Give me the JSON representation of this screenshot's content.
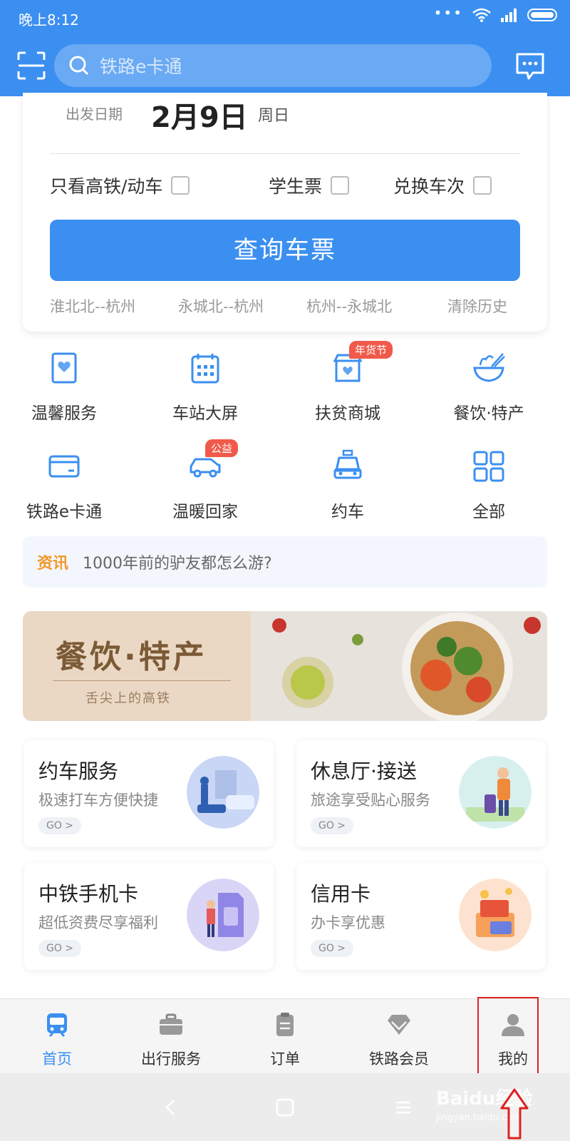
{
  "status_bar": {
    "time": "晚上8:12",
    "dots": "•••"
  },
  "header": {
    "search_placeholder": "铁路e卡通"
  },
  "query": {
    "date_label": "出发日期",
    "date_value": "2月9日",
    "weekday": "周日",
    "options": [
      "只看高铁/动车",
      "学生票",
      "兑换车次"
    ],
    "search_button": "查询车票",
    "history": [
      "淮北北--杭州",
      "永城北--杭州",
      "杭州--永城北"
    ],
    "clear_history": "清除历史"
  },
  "services": [
    {
      "label": "温馨服务",
      "icon": "heart-ticket-icon"
    },
    {
      "label": "车站大屏",
      "icon": "calendar-screen-icon"
    },
    {
      "label": "扶贫商城",
      "icon": "shop-icon",
      "tag": "年货节"
    },
    {
      "label": "餐饮·特产",
      "icon": "noodle-bowl-icon"
    },
    {
      "label": "铁路e卡通",
      "icon": "card-icon"
    },
    {
      "label": "温暖回家",
      "icon": "car-icon",
      "tag": "公益"
    },
    {
      "label": "约车",
      "icon": "taxi-icon"
    },
    {
      "label": "全部",
      "icon": "grid-icon"
    }
  ],
  "news": {
    "tag": "资讯",
    "headline": "1000年前的驴友都怎么游?"
  },
  "banner": {
    "title": "餐饮·特产",
    "subtitle": "舌尖上的高铁"
  },
  "feature_cards": [
    {
      "title": "约车服务",
      "subtitle": "极速打车方便快捷",
      "go": "GO >"
    },
    {
      "title": "休息厅·接送",
      "subtitle": "旅途享受贴心服务",
      "go": "GO >"
    },
    {
      "title": "中铁手机卡",
      "subtitle": "超低资费尽享福利",
      "go": "GO >"
    },
    {
      "title": "信用卡",
      "subtitle": "办卡享优惠",
      "go": "GO >"
    }
  ],
  "bottom_nav": [
    {
      "label": "首页",
      "icon": "train-icon",
      "active": true
    },
    {
      "label": "出行服务",
      "icon": "briefcase-icon"
    },
    {
      "label": "订单",
      "icon": "clipboard-icon"
    },
    {
      "label": "铁路会员",
      "icon": "diamond-icon"
    },
    {
      "label": "我的",
      "icon": "person-icon"
    }
  ],
  "watermark": {
    "brand": "Baidu经验",
    "url": "jingyan.baidu.com"
  },
  "colors": {
    "primary": "#3b8ff0",
    "accent_orange": "#f39a2a",
    "tag_red": "#f05a4b",
    "highlight_box": "#e02020"
  }
}
